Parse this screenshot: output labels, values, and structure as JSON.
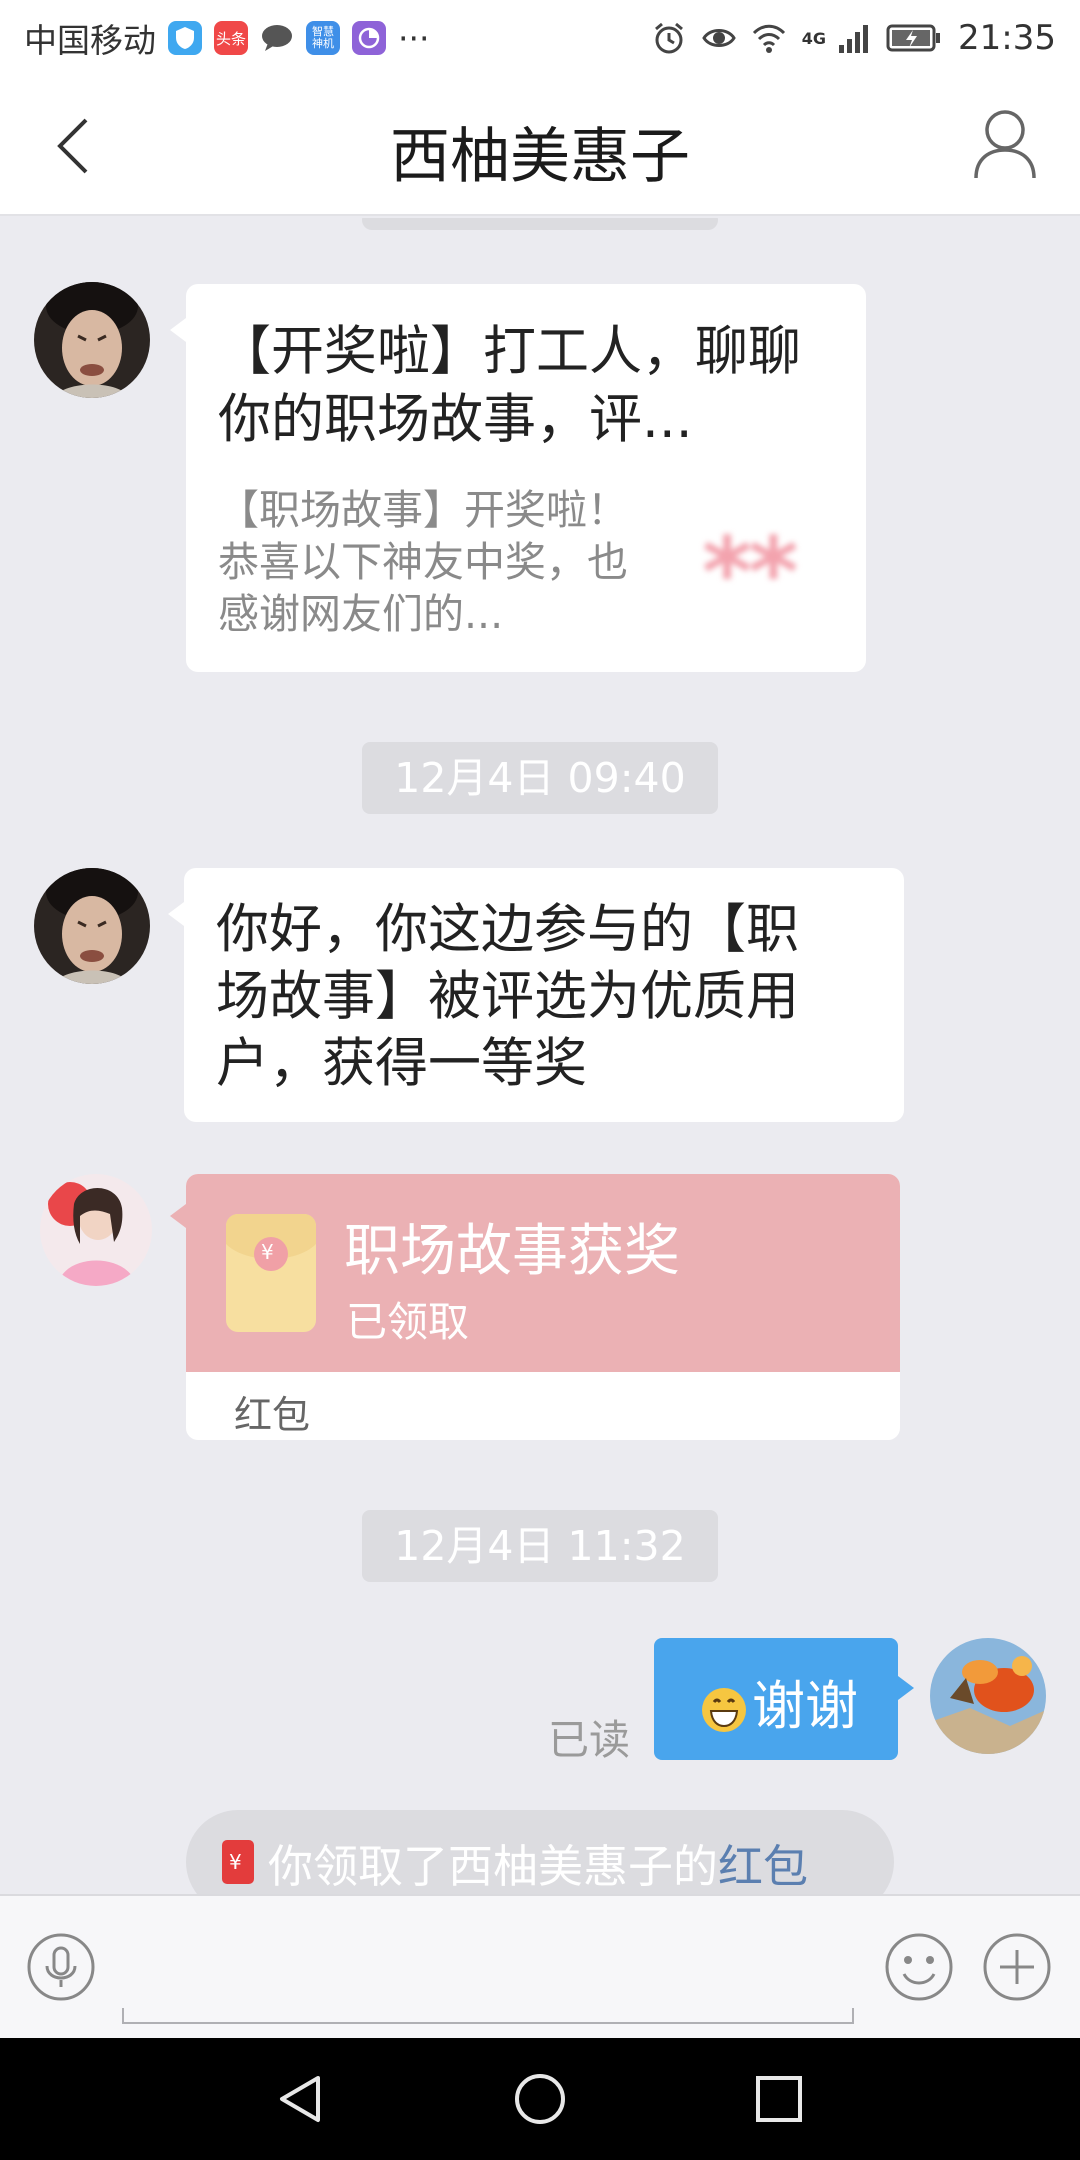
{
  "status_bar": {
    "carrier": "中国移动",
    "app_icons": [
      "shield-app-icon",
      "toutiao-app-icon",
      "chat-app-icon",
      "zhiyun-app-icon",
      "pie-app-icon"
    ],
    "toutiao_label": "头条",
    "zhiyun_label": "智慧\n神机",
    "more": "···",
    "network": "4G",
    "time": "21:35"
  },
  "header": {
    "title": "西柚美惠子"
  },
  "messages": [
    {
      "type": "link-card",
      "sender": "西柚美惠子",
      "title": "【开奖啦】打工人，聊聊你的职场故事，评...",
      "description": "【职场故事】开奖啦！恭喜以下神友中奖，也感谢网友们的...",
      "thumb_text": "**"
    },
    {
      "type": "timestamp",
      "text": "12月4日 09:40"
    },
    {
      "type": "text",
      "sender": "西柚美惠子",
      "text": "你好，你这边参与的【职场故事】被评选为优质用户，获得一等奖"
    },
    {
      "type": "red-packet",
      "title": "职场故事获奖",
      "status": "已领取",
      "label": "红包",
      "symbol": "¥"
    },
    {
      "type": "timestamp",
      "text": "12月4日 11:32"
    },
    {
      "type": "self-text",
      "read_receipt": "已读",
      "text": "谢谢"
    },
    {
      "type": "system",
      "text_prefix": "你领取了西柚美惠子的",
      "link": "红包",
      "symbol": "¥"
    }
  ],
  "colors": {
    "accent_blue": "#49a5ed",
    "red_packet": "#ebb1b4",
    "chat_bg": "#ebebf0"
  }
}
